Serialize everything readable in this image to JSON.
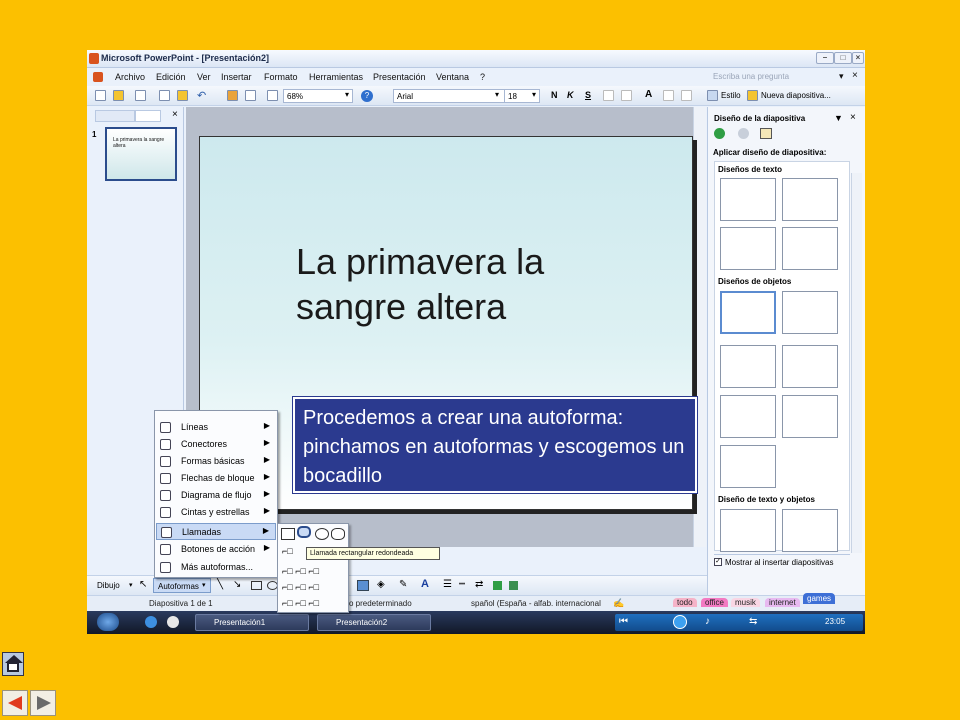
{
  "window": {
    "title": "Microsoft PowerPoint - [Presentación2]"
  },
  "menubar": {
    "items": [
      "Archivo",
      "Edición",
      "Ver",
      "Insertar",
      "Formato",
      "Herramientas",
      "Presentación",
      "Ventana",
      "?"
    ],
    "ask_placeholder": "Escriba una pregunta"
  },
  "toolbar": {
    "zoom": "68%",
    "font": "Arial",
    "font_size": "18",
    "bold": "N",
    "italic": "K",
    "underline": "S",
    "style_label": "Estilo",
    "new_slide_label": "Nueva diapositiva..."
  },
  "left_panel": {
    "slide_number": "1",
    "thumb_text": "La primavera la sangre altera"
  },
  "slide": {
    "title": "La primavera la sangre altera"
  },
  "task_pane": {
    "header": "Diseño de la diapositiva",
    "apply_label": "Aplicar diseño de diapositiva:",
    "sections": [
      "Diseños de texto",
      "Diseños de objetos",
      "Diseño de texto y objetos"
    ],
    "show_on_insert": "Mostrar al insertar diapositivas"
  },
  "draw_toolbar": {
    "draw_label": "Dibujo",
    "autoshapes_label": "Autoformas"
  },
  "autoshapes_menu": {
    "items": [
      {
        "label": "Líneas",
        "submenu": true
      },
      {
        "label": "Conectores",
        "submenu": true
      },
      {
        "label": "Formas básicas",
        "submenu": true
      },
      {
        "label": "Flechas de bloque",
        "submenu": true
      },
      {
        "label": "Diagrama de flujo",
        "submenu": true
      },
      {
        "label": "Cintas y estrellas",
        "submenu": true
      },
      {
        "label": "Llamadas",
        "submenu": true
      },
      {
        "label": "Botones de acción",
        "submenu": true
      },
      {
        "label": "Más autoformas...",
        "submenu": false
      }
    ],
    "highlighted": "Llamadas",
    "tooltip": "Llamada rectangular redondeada"
  },
  "status_bar": {
    "slide_info": "Diapositiva 1 de 1",
    "design": "o predeterminado",
    "language": "spañol (España - alfab. internacional",
    "tabs": [
      "todo",
      "office",
      "musik",
      "internet",
      "games"
    ]
  },
  "taskbar": {
    "tasks": [
      "Presentación1",
      "Presentación2"
    ],
    "clock": "23:05"
  },
  "callout": {
    "text": "Procedemos a crear una autoforma: pinchamos en autoformas y escogemos un bocadillo"
  },
  "colors": {
    "background": "#FCC000",
    "callout_fill": "#2B3A8F",
    "slide_gradient_top": "#CDE9EE"
  }
}
